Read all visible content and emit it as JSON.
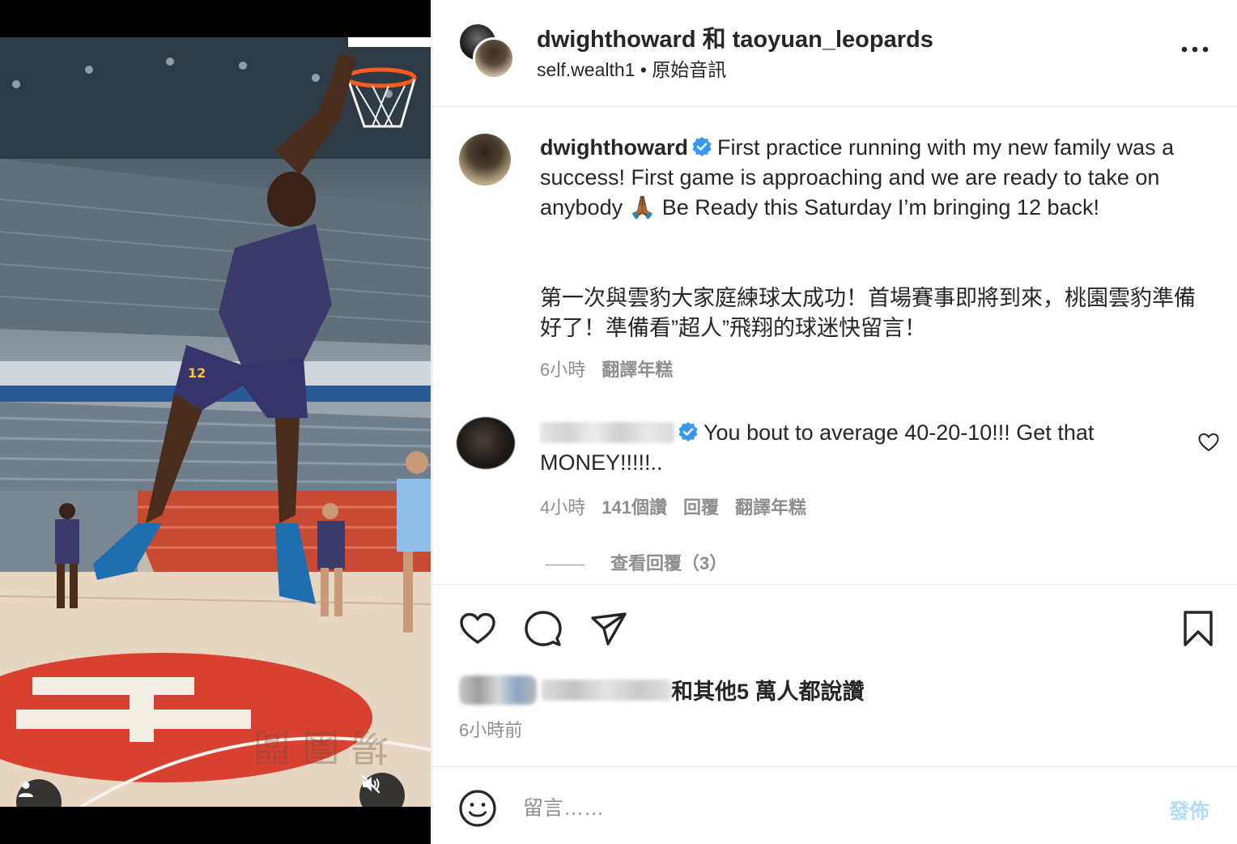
{
  "header": {
    "title": "dwighthoward 和 taoyuan_leopards",
    "subtitle": "self.wealth1 • 原始音訊"
  },
  "caption": {
    "username": "dwighthoward",
    "text_en": "First practice running with my new family was a success! First game is approaching and we are ready to take on anybody 🙏🏾 Be Ready this Saturday I’m bringing 12 back!",
    "text_zh": "第一次與雲豹大家庭練球太成功！首場賽事即將到來，桃園雲豹準備好了！準備看”超人”飛翔的球迷快留言！",
    "time": "6小時",
    "translate": "翻譯年糕"
  },
  "comment": {
    "text": "You bout to average 40-20-10!!! Get that MONEY!!!!!..",
    "time": "4小時",
    "likes": "141個讚",
    "reply": "回覆",
    "translate": "翻譯年糕",
    "view_replies": "查看回覆（3）"
  },
  "likes_summary": {
    "text": "和其他5 萬人都說讚"
  },
  "posted_time": "6小時前",
  "add_comment": {
    "placeholder": "留言……",
    "post_label": "發佈"
  },
  "icons": {
    "video": [
      "user-icon",
      "muted-speaker-icon"
    ],
    "header": [
      "more-options-icon"
    ],
    "actions": [
      "heart-icon",
      "comment-icon",
      "share-icon",
      "bookmark-icon"
    ],
    "comment_form": [
      "emoji-icon"
    ],
    "verified": "verified-badge-icon"
  },
  "colors": {
    "verified": "#3897f0",
    "text_primary": "#262626",
    "text_secondary": "#8e8e8e",
    "post_button_disabled": "#b3dbff"
  }
}
